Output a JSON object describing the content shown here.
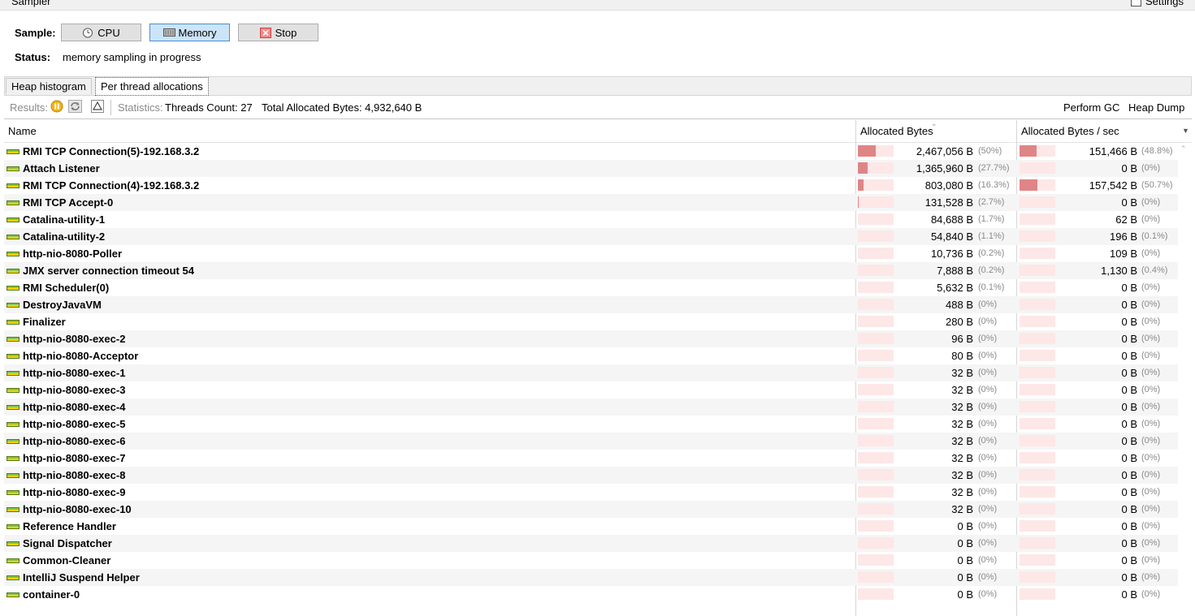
{
  "window": {
    "title": "Sampler",
    "settings_label": "Settings"
  },
  "sample": {
    "label": "Sample:",
    "buttons": [
      {
        "label": "CPU",
        "icon": "clock-icon",
        "active": false
      },
      {
        "label": "Memory",
        "icon": "memory-chip-icon",
        "active": true
      },
      {
        "label": "Stop",
        "icon": "stop-icon",
        "active": false
      }
    ]
  },
  "status": {
    "label": "Status:",
    "text": "memory sampling in progress"
  },
  "tabs": [
    {
      "label": "Heap histogram",
      "selected": false
    },
    {
      "label": "Per thread allocations",
      "selected": true
    }
  ],
  "toolbar": {
    "results_label": "Results:",
    "statistics_label": "Statistics:",
    "threads_count": "Threads Count: 27",
    "total_allocated": "Total Allocated Bytes: 4,932,640 B",
    "perform_gc": "Perform GC",
    "heap_dump": "Heap Dump"
  },
  "table": {
    "columns": [
      "Name",
      "Allocated Bytes",
      "Allocated Bytes / sec"
    ],
    "rows": [
      {
        "name": "RMI TCP Connection(5)-192.168.3.2",
        "alloc": "2,467,056 B",
        "alloc_pct": "(50%)",
        "alloc_frac": 0.5,
        "rate": "151,466 B",
        "rate_pct": "(48.8%)",
        "rate_frac": 0.488
      },
      {
        "name": "Attach Listener",
        "alloc": "1,365,960 B",
        "alloc_pct": "(27.7%)",
        "alloc_frac": 0.277,
        "rate": "0 B",
        "rate_pct": "(0%)",
        "rate_frac": 0
      },
      {
        "name": "RMI TCP Connection(4)-192.168.3.2",
        "alloc": "803,080 B",
        "alloc_pct": "(16.3%)",
        "alloc_frac": 0.163,
        "rate": "157,542 B",
        "rate_pct": "(50.7%)",
        "rate_frac": 0.507
      },
      {
        "name": "RMI TCP Accept-0",
        "alloc": "131,528 B",
        "alloc_pct": "(2.7%)",
        "alloc_frac": 0.027,
        "rate": "0 B",
        "rate_pct": "(0%)",
        "rate_frac": 0
      },
      {
        "name": "Catalina-utility-1",
        "alloc": "84,688 B",
        "alloc_pct": "(1.7%)",
        "alloc_frac": 0.017,
        "rate": "62 B",
        "rate_pct": "(0%)",
        "rate_frac": 0
      },
      {
        "name": "Catalina-utility-2",
        "alloc": "54,840 B",
        "alloc_pct": "(1.1%)",
        "alloc_frac": 0.011,
        "rate": "196 B",
        "rate_pct": "(0.1%)",
        "rate_frac": 0.001
      },
      {
        "name": "http-nio-8080-Poller",
        "alloc": "10,736 B",
        "alloc_pct": "(0.2%)",
        "alloc_frac": 0.002,
        "rate": "109 B",
        "rate_pct": "(0%)",
        "rate_frac": 0
      },
      {
        "name": "JMX server connection timeout 54",
        "alloc": "7,888 B",
        "alloc_pct": "(0.2%)",
        "alloc_frac": 0.002,
        "rate": "1,130 B",
        "rate_pct": "(0.4%)",
        "rate_frac": 0.004
      },
      {
        "name": "RMI Scheduler(0)",
        "alloc": "5,632 B",
        "alloc_pct": "(0.1%)",
        "alloc_frac": 0.001,
        "rate": "0 B",
        "rate_pct": "(0%)",
        "rate_frac": 0
      },
      {
        "name": "DestroyJavaVM",
        "alloc": "488 B",
        "alloc_pct": "(0%)",
        "alloc_frac": 0,
        "rate": "0 B",
        "rate_pct": "(0%)",
        "rate_frac": 0
      },
      {
        "name": "Finalizer",
        "alloc": "280 B",
        "alloc_pct": "(0%)",
        "alloc_frac": 0,
        "rate": "0 B",
        "rate_pct": "(0%)",
        "rate_frac": 0
      },
      {
        "name": "http-nio-8080-exec-2",
        "alloc": "96 B",
        "alloc_pct": "(0%)",
        "alloc_frac": 0,
        "rate": "0 B",
        "rate_pct": "(0%)",
        "rate_frac": 0
      },
      {
        "name": "http-nio-8080-Acceptor",
        "alloc": "80 B",
        "alloc_pct": "(0%)",
        "alloc_frac": 0,
        "rate": "0 B",
        "rate_pct": "(0%)",
        "rate_frac": 0
      },
      {
        "name": "http-nio-8080-exec-1",
        "alloc": "32 B",
        "alloc_pct": "(0%)",
        "alloc_frac": 0,
        "rate": "0 B",
        "rate_pct": "(0%)",
        "rate_frac": 0
      },
      {
        "name": "http-nio-8080-exec-3",
        "alloc": "32 B",
        "alloc_pct": "(0%)",
        "alloc_frac": 0,
        "rate": "0 B",
        "rate_pct": "(0%)",
        "rate_frac": 0
      },
      {
        "name": "http-nio-8080-exec-4",
        "alloc": "32 B",
        "alloc_pct": "(0%)",
        "alloc_frac": 0,
        "rate": "0 B",
        "rate_pct": "(0%)",
        "rate_frac": 0
      },
      {
        "name": "http-nio-8080-exec-5",
        "alloc": "32 B",
        "alloc_pct": "(0%)",
        "alloc_frac": 0,
        "rate": "0 B",
        "rate_pct": "(0%)",
        "rate_frac": 0
      },
      {
        "name": "http-nio-8080-exec-6",
        "alloc": "32 B",
        "alloc_pct": "(0%)",
        "alloc_frac": 0,
        "rate": "0 B",
        "rate_pct": "(0%)",
        "rate_frac": 0
      },
      {
        "name": "http-nio-8080-exec-7",
        "alloc": "32 B",
        "alloc_pct": "(0%)",
        "alloc_frac": 0,
        "rate": "0 B",
        "rate_pct": "(0%)",
        "rate_frac": 0
      },
      {
        "name": "http-nio-8080-exec-8",
        "alloc": "32 B",
        "alloc_pct": "(0%)",
        "alloc_frac": 0,
        "rate": "0 B",
        "rate_pct": "(0%)",
        "rate_frac": 0
      },
      {
        "name": "http-nio-8080-exec-9",
        "alloc": "32 B",
        "alloc_pct": "(0%)",
        "alloc_frac": 0,
        "rate": "0 B",
        "rate_pct": "(0%)",
        "rate_frac": 0
      },
      {
        "name": "http-nio-8080-exec-10",
        "alloc": "32 B",
        "alloc_pct": "(0%)",
        "alloc_frac": 0,
        "rate": "0 B",
        "rate_pct": "(0%)",
        "rate_frac": 0
      },
      {
        "name": "Reference Handler",
        "alloc": "0 B",
        "alloc_pct": "(0%)",
        "alloc_frac": 0,
        "rate": "0 B",
        "rate_pct": "(0%)",
        "rate_frac": 0
      },
      {
        "name": "Signal Dispatcher",
        "alloc": "0 B",
        "alloc_pct": "(0%)",
        "alloc_frac": 0,
        "rate": "0 B",
        "rate_pct": "(0%)",
        "rate_frac": 0
      },
      {
        "name": "Common-Cleaner",
        "alloc": "0 B",
        "alloc_pct": "(0%)",
        "alloc_frac": 0,
        "rate": "0 B",
        "rate_pct": "(0%)",
        "rate_frac": 0
      },
      {
        "name": "IntelliJ Suspend Helper",
        "alloc": "0 B",
        "alloc_pct": "(0%)",
        "alloc_frac": 0,
        "rate": "0 B",
        "rate_pct": "(0%)",
        "rate_frac": 0
      },
      {
        "name": "container-0",
        "alloc": "0 B",
        "alloc_pct": "(0%)",
        "alloc_frac": 0,
        "rate": "0 B",
        "rate_pct": "(0%)",
        "rate_frac": 0
      }
    ]
  },
  "colors": {
    "bar_fill": "#e08585",
    "bar_bg": "#fde7e7",
    "active_button": "#cce4f7"
  }
}
